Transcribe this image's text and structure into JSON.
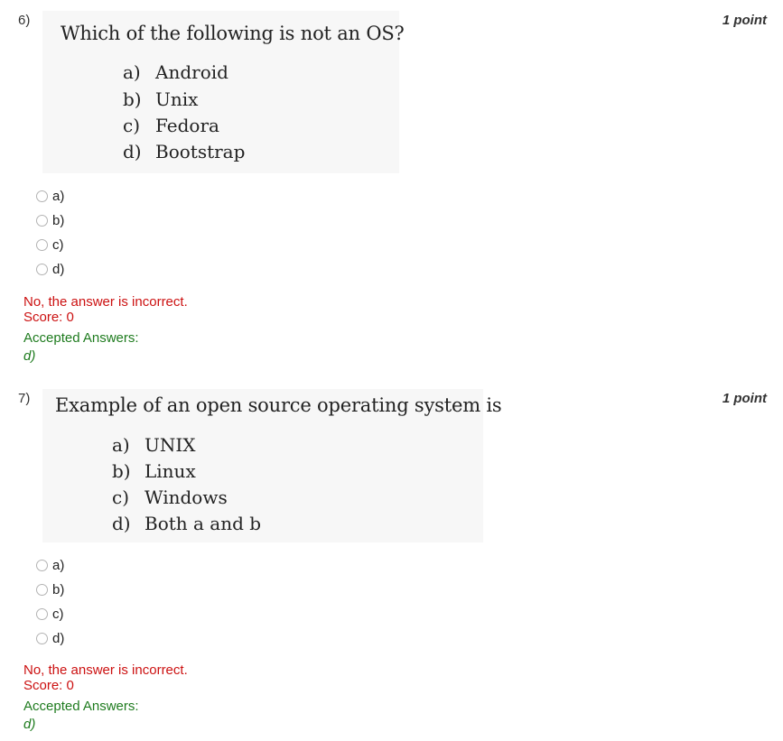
{
  "questions": [
    {
      "number": "6)",
      "points": "1 point",
      "question_text": "Which of the following is not an OS?",
      "image_options": [
        {
          "letter": "a)",
          "text": "Android"
        },
        {
          "letter": "b)",
          "text": "Unix"
        },
        {
          "letter": "c)",
          "text": "Fedora"
        },
        {
          "letter": "d)",
          "text": "Bootstrap"
        }
      ],
      "choices": [
        "a)",
        "b)",
        "c)",
        "d)"
      ],
      "feedback": "No, the answer is incorrect.",
      "score": "Score: 0",
      "accepted_label": "Accepted Answers:",
      "accepted_answer": "d)"
    },
    {
      "number": "7)",
      "points": "1 point",
      "question_text": "Example of an open source operating system is",
      "image_options": [
        {
          "letter": "a)",
          "text": "UNIX"
        },
        {
          "letter": "b)",
          "text": "Linux"
        },
        {
          "letter": "c)",
          "text": "Windows"
        },
        {
          "letter": "d)",
          "text": "Both a and b"
        }
      ],
      "choices": [
        "a)",
        "b)",
        "c)",
        "d)"
      ],
      "feedback": "No, the answer is incorrect.",
      "score": "Score: 0",
      "accepted_label": "Accepted Answers:",
      "accepted_answer": "d)"
    }
  ]
}
